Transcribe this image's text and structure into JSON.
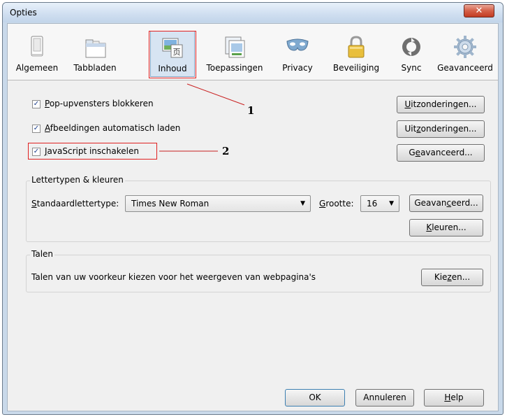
{
  "window": {
    "title": "Opties",
    "close_glyph": "✕"
  },
  "tabs": [
    {
      "label": "Algemeen",
      "icon": "switch-icon"
    },
    {
      "label": "Tabbladen",
      "icon": "tabs-icon"
    },
    {
      "label": "Inhoud",
      "icon": "content-icon"
    },
    {
      "label": "Toepassingen",
      "icon": "applications-icon"
    },
    {
      "label": "Privacy",
      "icon": "mask-icon"
    },
    {
      "label": "Beveiliging",
      "icon": "lock-icon"
    },
    {
      "label": "Sync",
      "icon": "sync-icon"
    },
    {
      "label": "Geavanceerd",
      "icon": "gear-icon"
    }
  ],
  "selected_tab": "Inhoud",
  "content": {
    "popups": {
      "pre": "",
      "ul": "P",
      "post": "op-upvensters blokkeren",
      "checked": true,
      "button": {
        "pre": "",
        "ul": "U",
        "post": "itzonderingen..."
      }
    },
    "images": {
      "pre": "",
      "ul": "A",
      "post": "fbeeldingen automatisch laden",
      "checked": true,
      "button": {
        "pre": "Uit",
        "ul": "z",
        "post": "onderingen..."
      }
    },
    "javascript": {
      "pre": "",
      "ul": "J",
      "post": "avaScript inschakelen",
      "checked": true,
      "button": {
        "pre": "G",
        "ul": "e",
        "post": "avanceerd..."
      }
    }
  },
  "fonts_group": {
    "label": "Lettertypen & kleuren",
    "default_font_label": {
      "pre": "",
      "ul": "S",
      "post": "tandaardlettertype:"
    },
    "default_font_value": "Times New Roman",
    "size_label": {
      "pre": "",
      "ul": "G",
      "post": "rootte:"
    },
    "size_value": "16",
    "advanced_button": {
      "pre": "Geavan",
      "ul": "c",
      "post": "eerd..."
    },
    "colors_button": {
      "pre": "",
      "ul": "K",
      "post": "leuren..."
    }
  },
  "languages_group": {
    "label": "Talen",
    "description": "Talen van uw voorkeur kiezen voor het weergeven van webpagina's",
    "choose_button": {
      "pre": "Kie",
      "ul": "z",
      "post": "en..."
    }
  },
  "footer": {
    "ok": {
      "pre": "",
      "ul": "",
      "post": "OK"
    },
    "cancel": {
      "pre": "",
      "ul": "",
      "post": "Annuleren"
    },
    "help": {
      "pre": "",
      "ul": "H",
      "post": "elp"
    }
  },
  "annotations": {
    "one": "1",
    "two": "2"
  },
  "colors": {
    "annotation_red": "#e02020",
    "selected_tab_bg": "#d7e4f2",
    "checkmark": "#1d3f8c"
  }
}
